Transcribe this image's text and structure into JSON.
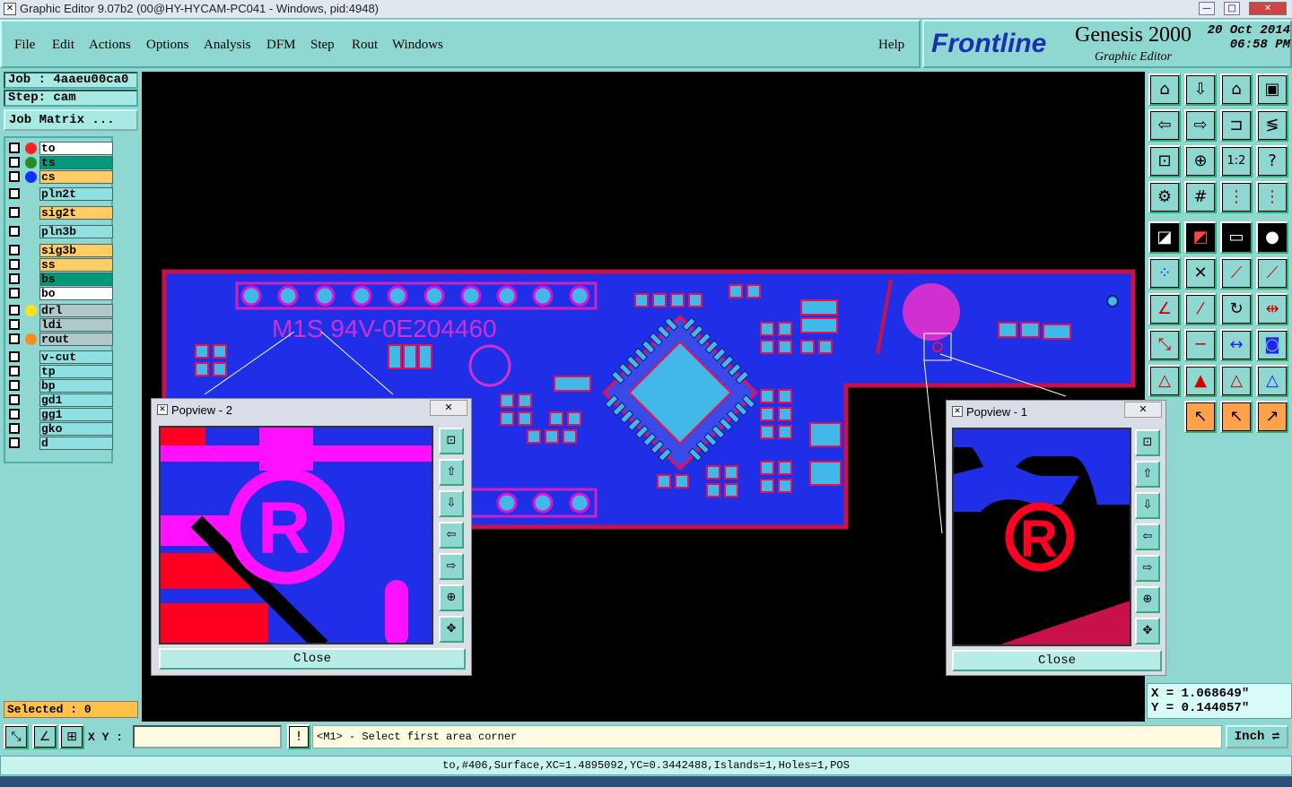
{
  "window": {
    "title": "Graphic Editor 9.07b2 (00@HY-HYCAM-PC041 - Windows, pid:4948)",
    "min": "—",
    "max": "□",
    "close": "✕"
  },
  "menu": {
    "file": "File",
    "edit": "Edit",
    "actions": "Actions",
    "options": "Options",
    "analysis": "Analysis",
    "dfm": "DFM",
    "step": "Step",
    "rout": "Rout",
    "windows": "Windows",
    "help": "Help"
  },
  "brand": {
    "logo": "Frontline",
    "product": "Genesis 2000",
    "subtitle": "Graphic Editor",
    "date": "20 Oct 2014",
    "time": "06:58 PM"
  },
  "job": {
    "job": "Job : 4aaeu00ca0",
    "step": "Step: cam",
    "matrix": "Job Matrix ..."
  },
  "layers": [
    {
      "name": "to",
      "bg": "#ffffff",
      "dot": "#ff2020"
    },
    {
      "name": "ts",
      "bg": "#009a7a",
      "dot": "#2a8a2a"
    },
    {
      "name": "cs",
      "bg": "#ffcc66",
      "dot": "#1030ff"
    },
    {
      "name": "pln2t",
      "bg": "#8fe0e0",
      "dot": ""
    },
    {
      "name": "sig2t",
      "bg": "#ffcc66",
      "dot": ""
    },
    {
      "name": "pln3b",
      "bg": "#8fe0e0",
      "dot": ""
    },
    {
      "name": "sig3b",
      "bg": "#ffcc66",
      "dot": ""
    },
    {
      "name": "ss",
      "bg": "#ffcc66",
      "dot": ""
    },
    {
      "name": "bs",
      "bg": "#009a7a",
      "dot": ""
    },
    {
      "name": "bo",
      "bg": "#ffffff",
      "dot": ""
    },
    {
      "name": "drl",
      "bg": "#b0c8c8",
      "dot": "#ffe020"
    },
    {
      "name": "ldi",
      "bg": "#b0c8c8",
      "dot": ""
    },
    {
      "name": "rout",
      "bg": "#b0c8c8",
      "dot": "#ff8a20"
    },
    {
      "name": "v-cut",
      "bg": "#8fe0e0",
      "dot": ""
    },
    {
      "name": "tp",
      "bg": "#8fe0e0",
      "dot": ""
    },
    {
      "name": "bp",
      "bg": "#8fe0e0",
      "dot": ""
    },
    {
      "name": "gd1",
      "bg": "#8fe0e0",
      "dot": ""
    },
    {
      "name": "gg1",
      "bg": "#8fe0e0",
      "dot": ""
    },
    {
      "name": "gko",
      "bg": "#8fe0e0",
      "dot": ""
    },
    {
      "name": "d",
      "bg": "#8fe0e0",
      "dot": ""
    }
  ],
  "selected": "Selected : 0",
  "board": {
    "marking": "M1S 94V-0E204460"
  },
  "popview2": {
    "title": "Popview - 2",
    "close": "Close",
    "x": "✕"
  },
  "popview1": {
    "title": "Popview - 1",
    "close": "Close",
    "x": "✕"
  },
  "coords": {
    "x": "X = 1.068649\"",
    "y": "Y = 0.144057\""
  },
  "cmd": {
    "xy_label": "X Y :",
    "xy_value": "",
    "prompt": "<M1> - Select first area corner",
    "units": "Inch",
    "warn": "!"
  },
  "status": "to,#406,Surface,XC=1.4895092,YC=0.3442488,Islands=1,Holes=1,POS"
}
